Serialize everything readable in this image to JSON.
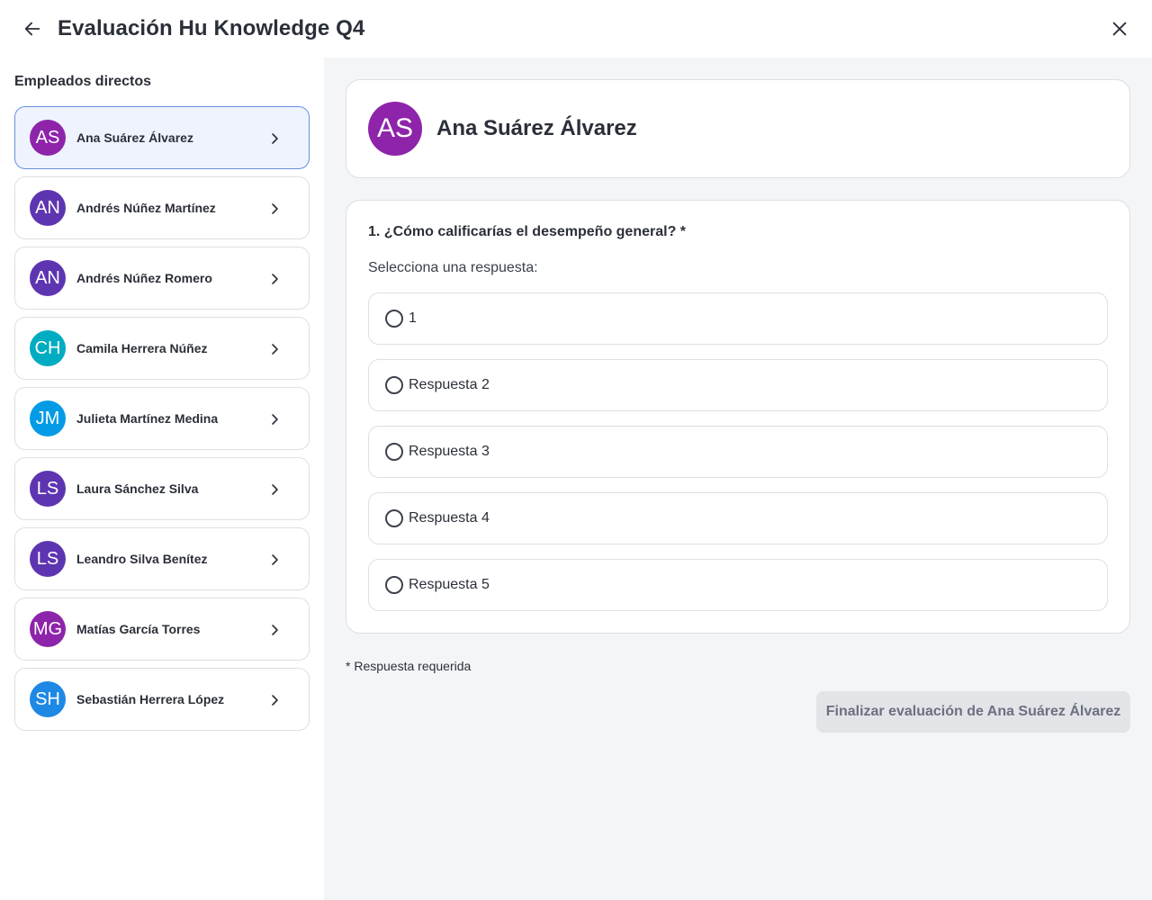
{
  "header": {
    "title": "Evaluación Hu Knowledge Q4"
  },
  "sidebar": {
    "title": "Empleados directos",
    "employees": [
      {
        "initials": "AS",
        "name": "Ana Suárez Álvarez",
        "color": "#8e24aa"
      },
      {
        "initials": "AN",
        "name": "Andrés Núñez Martínez",
        "color": "#5e35b1"
      },
      {
        "initials": "AN",
        "name": "Andrés Núñez Romero",
        "color": "#5e35b1"
      },
      {
        "initials": "CH",
        "name": "Camila Herrera Núñez",
        "color": "#00acc1"
      },
      {
        "initials": "JM",
        "name": "Julieta Martínez Medina",
        "color": "#039be5"
      },
      {
        "initials": "LS",
        "name": "Laura Sánchez Silva",
        "color": "#5e35b1"
      },
      {
        "initials": "LS",
        "name": "Leandro Silva Benítez",
        "color": "#5e35b1"
      },
      {
        "initials": "MG",
        "name": "Matías García Torres",
        "color": "#8e24aa"
      },
      {
        "initials": "SH",
        "name": "Sebastián Herrera López",
        "color": "#1e88e5"
      }
    ]
  },
  "profile": {
    "initials": "AS",
    "name": "Ana Suárez Álvarez",
    "color": "#8e24aa"
  },
  "question": {
    "text": "1. ¿Cómo calificarías el desempeño general? *",
    "instruction": "Selecciona una respuesta:",
    "options": [
      "1",
      "Respuesta 2",
      "Respuesta 3",
      "Respuesta 4",
      "Respuesta 5"
    ]
  },
  "footer": {
    "required_note": "* Respuesta requerida",
    "finish_label": "Finalizar evaluación de Ana Suárez Álvarez"
  },
  "icons": {
    "back": "arrow-left-icon",
    "close": "close-icon",
    "chevron": "chevron-right-icon"
  }
}
